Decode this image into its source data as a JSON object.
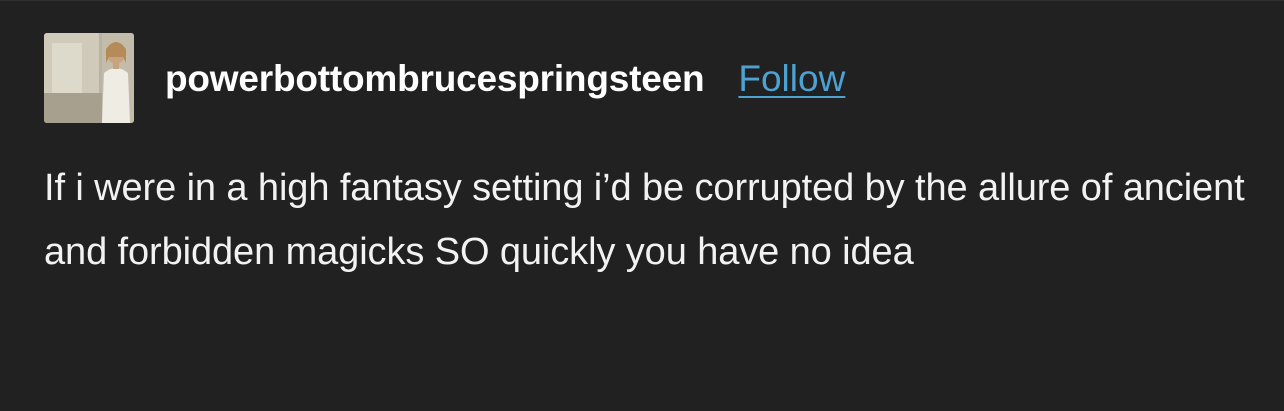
{
  "post": {
    "author": {
      "username": "powerbottombrucespringsteen",
      "avatar_icon": "avatar-photo"
    },
    "follow_label": "Follow",
    "text": "If i were in a high fantasy setting i’d be corrupted by the allure of ancient and forbidden magicks SO quickly you have no idea"
  },
  "colors": {
    "background": "#212121",
    "text": "#f2f2f2",
    "link": "#4ea1d3"
  }
}
